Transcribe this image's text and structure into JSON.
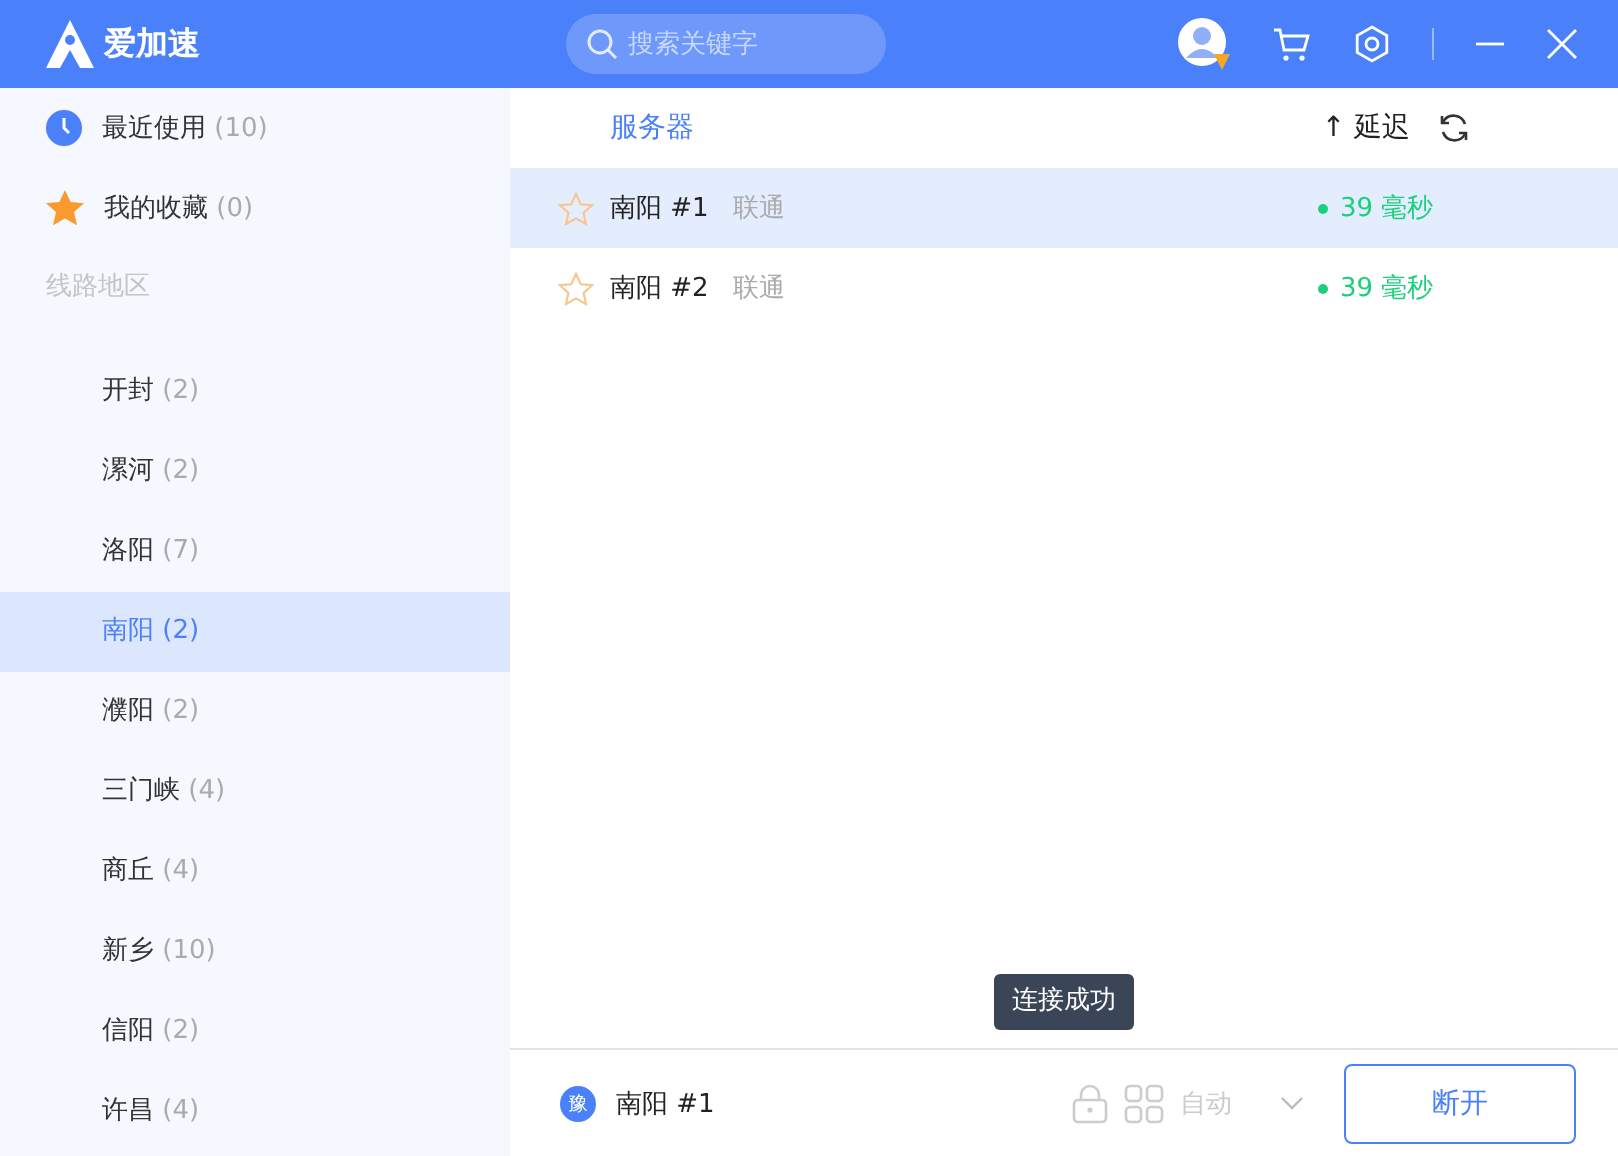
{
  "app": {
    "name": "爱加速"
  },
  "search": {
    "placeholder": "搜索关键字"
  },
  "sidebar": {
    "shortcuts": [
      {
        "kind": "recent",
        "label": "最近使用",
        "count": "(10)"
      },
      {
        "kind": "favorites",
        "label": "我的收藏",
        "count": "(0)"
      }
    ],
    "section_title": "线路地区",
    "regions": [
      {
        "name": "开封",
        "count": "(2)",
        "selected": false
      },
      {
        "name": "漯河",
        "count": "(2)",
        "selected": false
      },
      {
        "name": "洛阳",
        "count": "(7)",
        "selected": false
      },
      {
        "name": "南阳",
        "count": "(2)",
        "selected": true
      },
      {
        "name": "濮阳",
        "count": "(2)",
        "selected": false
      },
      {
        "name": "三门峡",
        "count": "(4)",
        "selected": false
      },
      {
        "name": "商丘",
        "count": "(4)",
        "selected": false
      },
      {
        "name": "新乡",
        "count": "(10)",
        "selected": false
      },
      {
        "name": "信阳",
        "count": "(2)",
        "selected": false
      },
      {
        "name": "许昌",
        "count": "(4)",
        "selected": false
      }
    ]
  },
  "server_list": {
    "column_server": "服务器",
    "sort_arrow": "↑",
    "column_latency": "延迟",
    "rows": [
      {
        "name": "南阳 #1",
        "isp": "联通",
        "latency": "39 毫秒",
        "selected": true,
        "favorite": false
      },
      {
        "name": "南阳 #2",
        "isp": "联通",
        "latency": "39 毫秒",
        "selected": false,
        "favorite": false
      }
    ]
  },
  "tooltip": "连接成功",
  "footer": {
    "badge": "豫",
    "server": "南阳 #1",
    "mode": "自动",
    "button": "断开"
  }
}
